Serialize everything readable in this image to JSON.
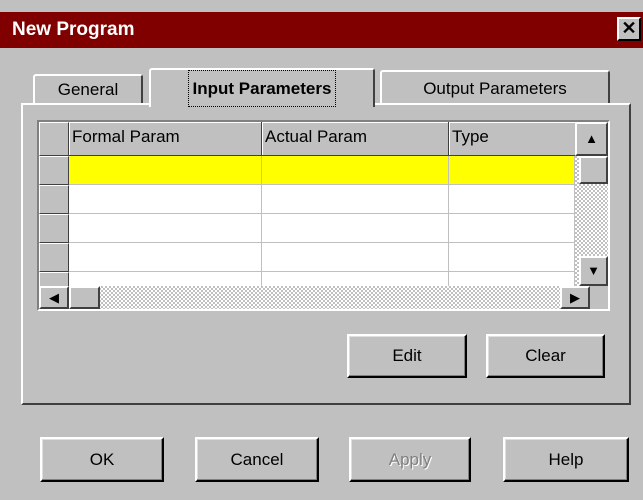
{
  "window": {
    "title": "New Program",
    "close_glyph": "✕"
  },
  "tabs": [
    {
      "label": "General",
      "active": false
    },
    {
      "label": "Input Parameters",
      "active": true
    },
    {
      "label": "Output Parameters",
      "active": false
    }
  ],
  "grid": {
    "columns": [
      "Formal Param",
      "Actual Param",
      "Type"
    ],
    "rows": [
      {
        "formal": "",
        "actual": "",
        "type": "",
        "selected": true
      },
      {
        "formal": "",
        "actual": "",
        "type": "",
        "selected": false
      },
      {
        "formal": "",
        "actual": "",
        "type": "",
        "selected": false
      },
      {
        "formal": "",
        "actual": "",
        "type": "",
        "selected": false
      }
    ],
    "highlight_color": "#ffff00"
  },
  "panel_buttons": {
    "edit": "Edit",
    "clear": "Clear"
  },
  "dialog_buttons": {
    "ok": "OK",
    "cancel": "Cancel",
    "apply": "Apply",
    "help": "Help"
  },
  "colors": {
    "titlebar": "#800000",
    "face": "#c0c0c0"
  },
  "icons": {
    "scroll_up": "▲",
    "scroll_down": "▼",
    "scroll_left": "◀",
    "scroll_right": "▶"
  }
}
